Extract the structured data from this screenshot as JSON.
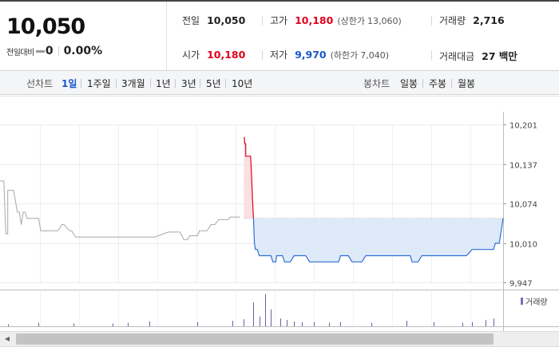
{
  "header": {
    "price": "10,050",
    "change_label": "전일대비",
    "change_value": "0",
    "change_rate": "0.00%",
    "stats": {
      "prev_close": {
        "label": "전일",
        "value": "10,050"
      },
      "high": {
        "label": "고가",
        "value": "10,180",
        "limit_label": "(상한가",
        "limit_value": "13,060",
        "close": ")"
      },
      "volume": {
        "label": "거래량",
        "value": "2,716"
      },
      "open": {
        "label": "시가",
        "value": "10,180"
      },
      "low": {
        "label": "저가",
        "value": "9,970",
        "limit_label": "(하한가",
        "limit_value": "7,040",
        "close": ")"
      },
      "trade_amount": {
        "label": "거래대금",
        "value": "27 백만"
      }
    },
    "colors": {
      "up": "#e0001e",
      "down": "#1a58c8"
    }
  },
  "toolbar": {
    "line_label": "선차트",
    "line_periods": [
      "1일",
      "1주일",
      "3개월",
      "1년",
      "3년",
      "5년",
      "10년"
    ],
    "active_period": "1일",
    "candle_label": "봉차트",
    "candle_periods": [
      "일봉",
      "주봉",
      "월봉"
    ]
  },
  "chart_data": {
    "type": "line",
    "ylim": [
      9947,
      10201
    ],
    "y_ticks": [
      10201,
      10137,
      10074,
      10010,
      9947
    ],
    "y_tick_labels": [
      "10,201",
      "10,137",
      "10,074",
      "10,010",
      "9,947"
    ],
    "reference_price": 10050,
    "grid": true,
    "legend": {
      "label": "거래량",
      "placement": "top-right"
    },
    "colors": {
      "up": "#e0001e",
      "down": "#2f6fd6",
      "prev": "#a8a8a8",
      "up_fill": "#f9dde0",
      "down_fill": "#dce8f8"
    },
    "prev_series": {
      "name": "",
      "x": [
        0,
        2,
        3,
        4,
        4,
        7,
        9,
        10,
        11,
        12,
        13,
        14,
        20,
        21,
        24,
        30,
        32,
        33,
        36,
        37,
        39,
        40,
        49,
        50,
        56,
        60,
        64,
        79,
        80,
        87,
        93,
        95,
        97,
        98,
        102,
        103,
        107,
        109,
        111,
        113,
        118,
        119,
        124
      ],
      "values": [
        10110,
        10110,
        10025,
        10025,
        10095,
        10095,
        10060,
        10060,
        10040,
        10060,
        10060,
        10050,
        10050,
        10030,
        10030,
        10030,
        10040,
        10040,
        10030,
        10030,
        10020,
        10020,
        10020,
        10020,
        10020,
        10020,
        10020,
        10020,
        10020,
        10028,
        10028,
        10016,
        10016,
        10022,
        10022,
        10030,
        10030,
        10040,
        10040,
        10048,
        10048,
        10052,
        10052
      ]
    },
    "series": [
      {
        "name": "",
        "x": [
          126,
          126.3,
          126.5,
          127,
          127,
          128,
          128,
          129.5,
          130,
          130.5,
          131
        ],
        "values": [
          10180,
          10180,
          10170,
          10170,
          10150,
          10150,
          10150,
          10150,
          10120,
          10080,
          10050
        ]
      },
      {
        "name": "",
        "x": [
          131,
          131.5,
          132,
          133,
          134,
          136,
          138,
          139,
          140,
          141,
          142,
          142.5,
          143,
          144,
          146,
          147,
          150,
          152,
          158,
          160,
          175,
          176,
          180,
          182,
          187,
          189,
          192,
          194,
          201,
          210,
          212,
          213,
          216,
          218,
          220,
          222,
          240,
          241,
          244,
          246,
          250,
          254,
          255,
          256,
          258,
          260
        ],
        "values": [
          10050,
          10010,
          10000,
          10000,
          9990,
          9990,
          9990,
          9990,
          9990,
          9980,
          9980,
          9980,
          9990,
          9990,
          9990,
          9980,
          9980,
          9990,
          9990,
          9980,
          9980,
          9990,
          9990,
          9980,
          9980,
          9990,
          9990,
          9990,
          9990,
          9990,
          9990,
          9980,
          9980,
          9990,
          9990,
          9990,
          9990,
          9990,
          10000,
          10000,
          10000,
          10000,
          10000,
          10010,
          10010,
          10050
        ]
      }
    ],
    "volume": {
      "x": [
        4,
        20,
        38,
        58,
        66,
        77,
        102,
        120,
        126,
        131,
        134,
        137,
        140,
        145,
        148,
        152,
        156,
        162,
        170,
        176,
        192,
        210,
        224,
        239,
        244,
        251,
        255
      ],
      "values": [
        3,
        5,
        4,
        4,
        5,
        7,
        6,
        8,
        10,
        34,
        14,
        46,
        24,
        11,
        9,
        7,
        6,
        6,
        5,
        6,
        5,
        8,
        6,
        5,
        6,
        9,
        11
      ]
    }
  }
}
